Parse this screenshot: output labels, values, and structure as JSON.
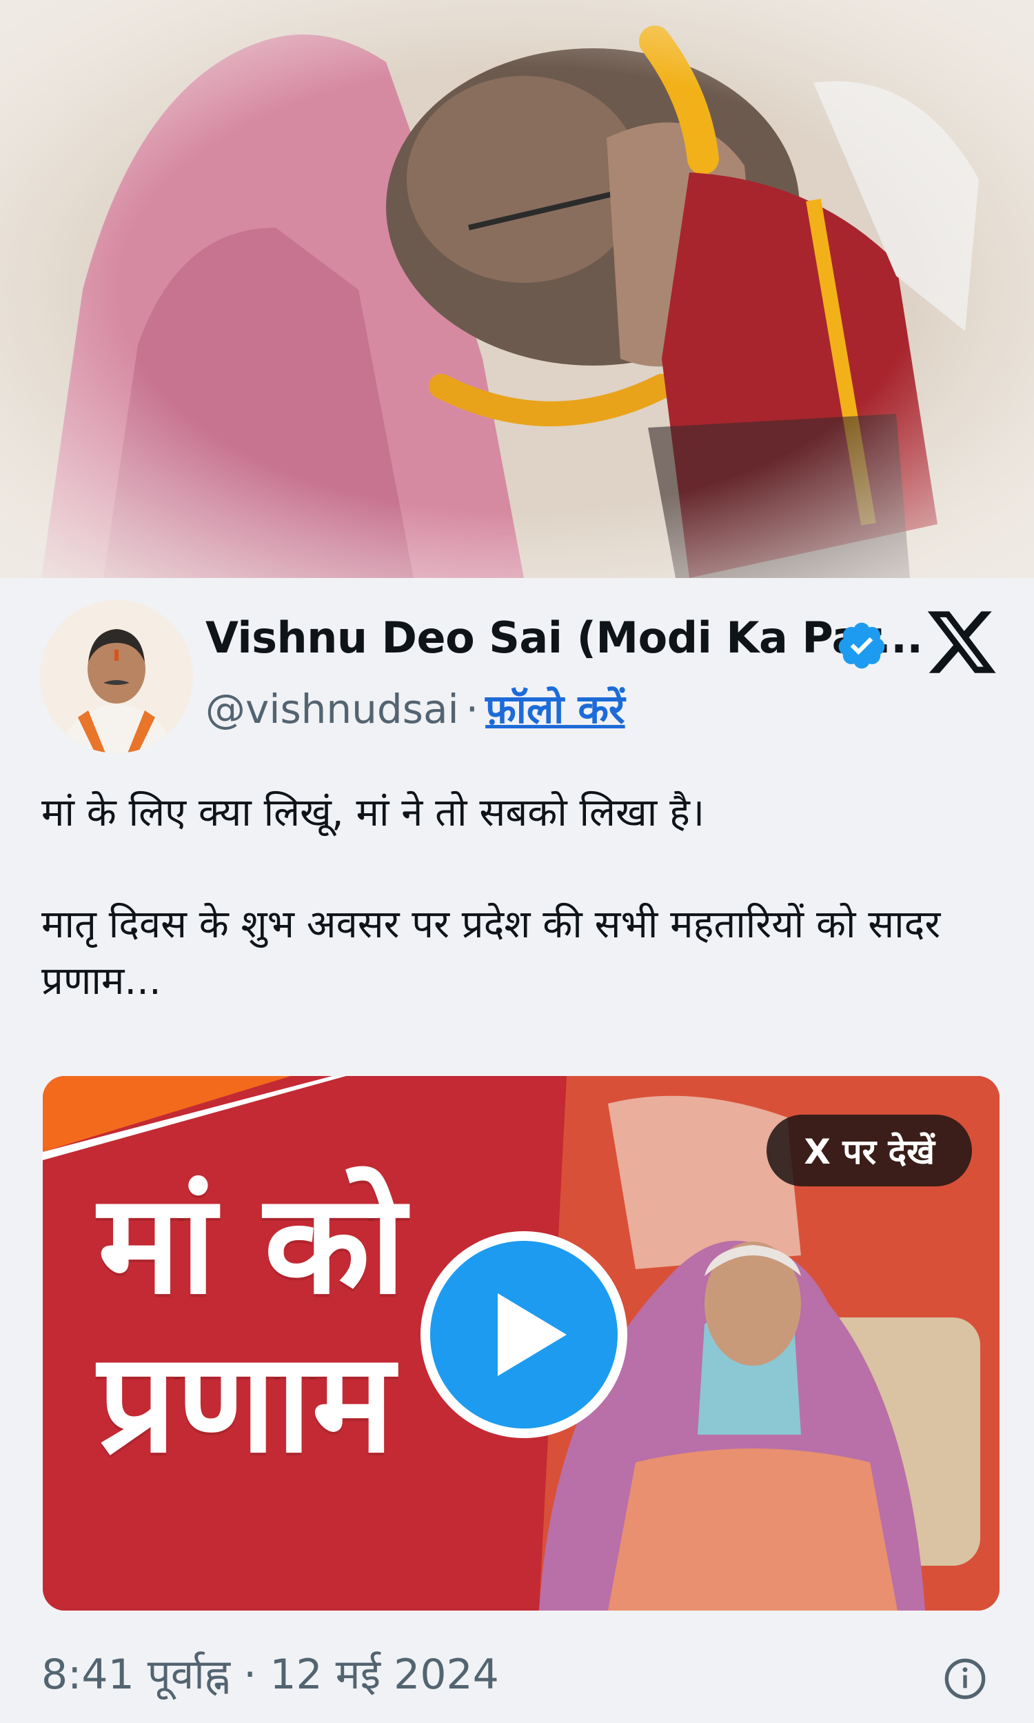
{
  "tweet": {
    "author_name": "Vishnu Deo Sai (Modi Ka Par...",
    "handle": "@vishnudsai",
    "separator": "·",
    "follow_label": "फ़ॉलो करें",
    "text_lines": [
      "मां के लिए क्या लिखूं, मां ने तो सबको लिखा है।",
      "मातृ दिवस के शुभ अवसर पर प्रदेश की सभी महतारियों को सादर प्रणाम..."
    ],
    "media": {
      "view_on_x_label": "X पर देखें",
      "graphic_text": "मां को प्रणाम"
    },
    "timestamp": "8:41 पूर्वाह्न · 12 मई 2024"
  },
  "icons": {
    "verified": "verified-badge-icon",
    "x_logo": "x-logo-icon",
    "play": "play-icon",
    "info": "info-icon"
  },
  "colors": {
    "accent": "#1d9bf0",
    "link": "#1d6bd8",
    "media_red": "#c62d35",
    "muted_text": "#536471"
  }
}
